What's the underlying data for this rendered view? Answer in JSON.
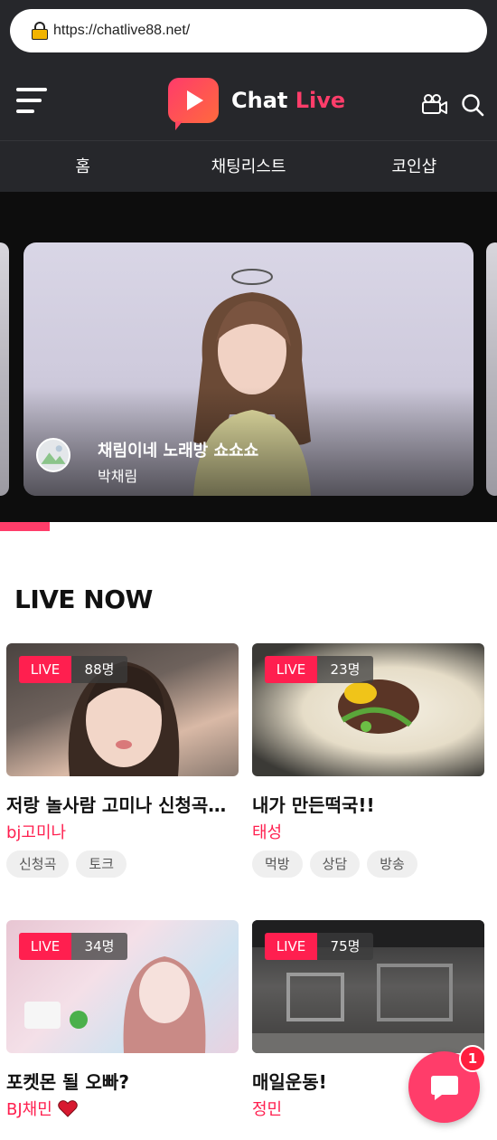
{
  "browser": {
    "url": "https://chatlive88.net/"
  },
  "header": {
    "logo_text_1": "Chat",
    "logo_text_2": "Live",
    "menu_icon": "hamburger-menu-icon",
    "camera_icon": "video-camera-icon",
    "search_icon": "search-icon"
  },
  "nav": {
    "items": [
      {
        "label": "홈"
      },
      {
        "label": "채팅리스트"
      },
      {
        "label": "코인샵"
      }
    ]
  },
  "carousel": {
    "title": "채림이네 노래방 쇼쇼쇼",
    "streamer": "박채림",
    "progress": 0.1
  },
  "live_now": {
    "heading": "LIVE NOW",
    "live_label": "LIVE",
    "streams": [
      {
        "viewers": "88명",
        "title": "저랑 놀사람 고미나 신청곡…",
        "author": "bj고미나",
        "tags": [
          "신청곡",
          "토크"
        ]
      },
      {
        "viewers": "23명",
        "title": "내가 만든떡국!!",
        "author": "태성",
        "tags": [
          "먹방",
          "상담",
          "방송"
        ]
      },
      {
        "viewers": "34명",
        "title": "포켓몬 될 오빠?",
        "author": "BJ채민",
        "tags": []
      },
      {
        "viewers": "75명",
        "title": "매일운동!",
        "author": "정민",
        "tags": []
      }
    ]
  },
  "chat_fab": {
    "icon": "chat-bubble-icon",
    "badge": "1"
  },
  "colors": {
    "accent": "#ff3d6a",
    "live_badge": "#ff1f4f",
    "header_bg": "#26272b"
  }
}
